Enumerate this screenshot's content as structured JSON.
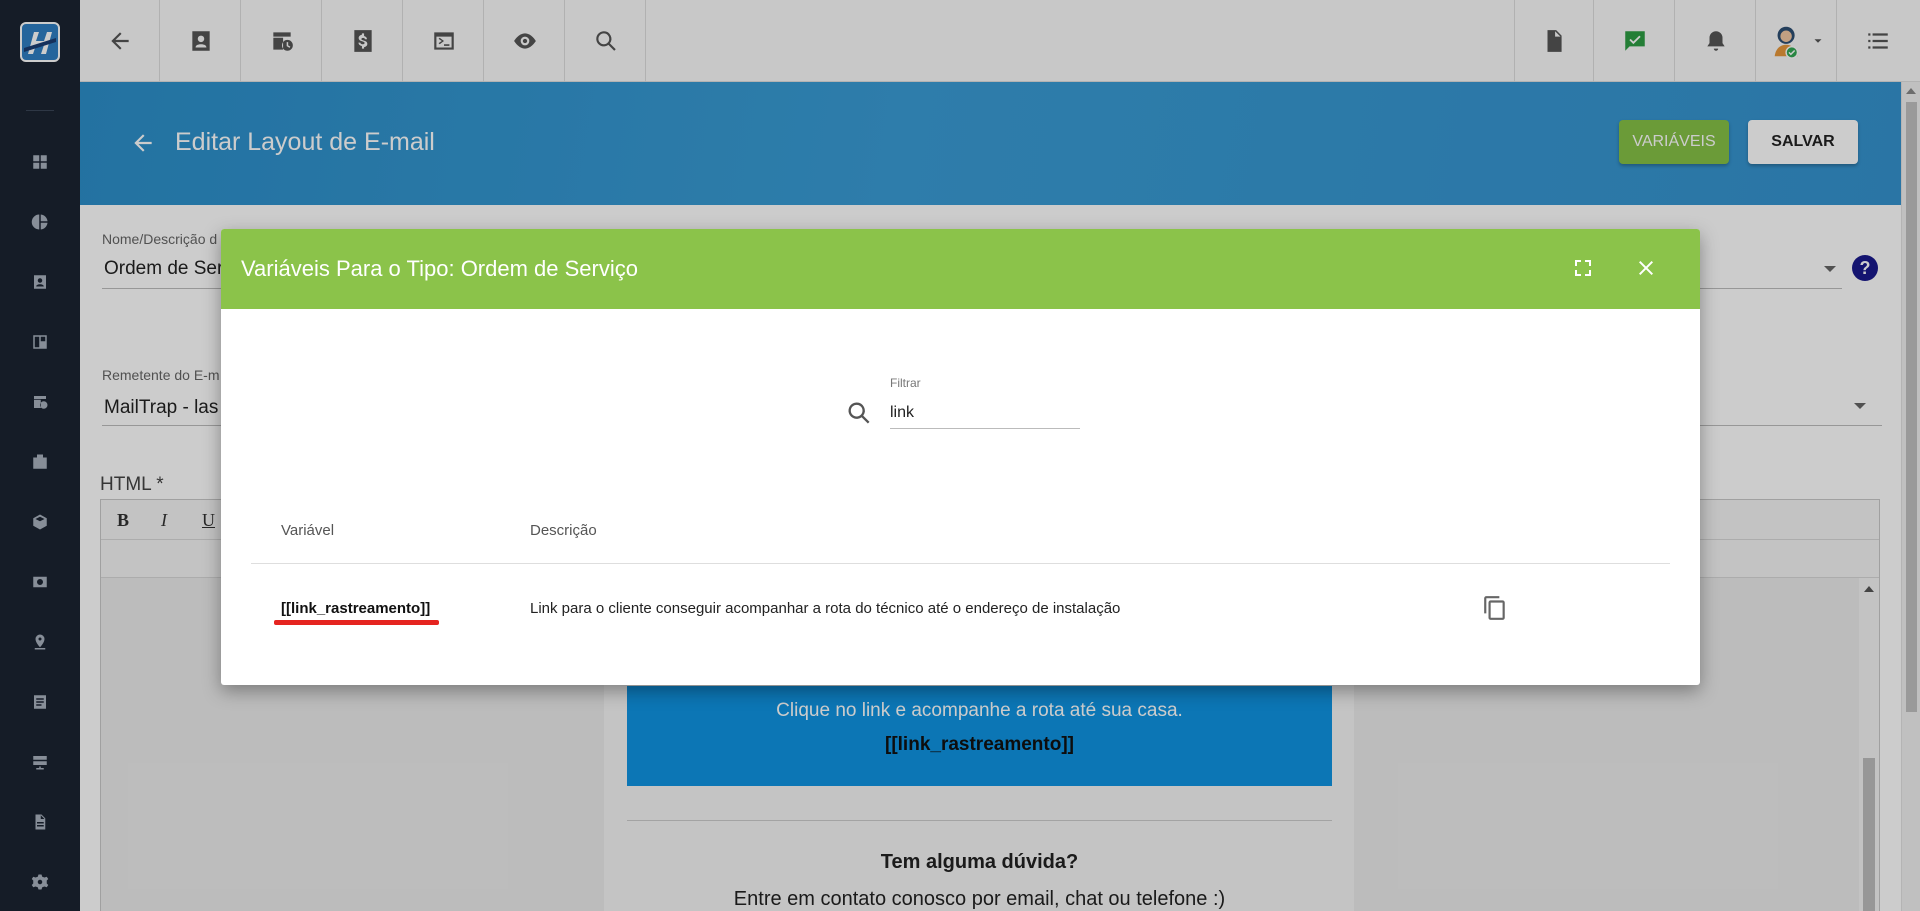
{
  "header": {
    "title": "Editar Layout de E-mail",
    "vars_button": "VARIÁVEIS",
    "save_button": "SALVAR"
  },
  "form": {
    "name_label": "Nome/Descrição d",
    "name_value": "Ordem de Ser",
    "sender_label": "Remetente do E-m",
    "sender_value": "MailTrap - las",
    "html_label": "HTML *",
    "help": "?"
  },
  "editor": {
    "tools": [
      "B",
      "I",
      "U"
    ]
  },
  "email_preview": {
    "line1": "Clique no link e acompanhe a rota até sua casa.",
    "line2": "[[link_rastreamento]]",
    "question": "Tem alguma dúvida?",
    "contact": "Entre em contato conosco por email, chat ou telefone :)"
  },
  "dialog": {
    "title": "Variáveis Para o Tipo: Ordem de Serviço",
    "filter_label": "Filtrar",
    "filter_value": "link",
    "col_variable": "Variável",
    "col_description": "Descrição",
    "rows": [
      {
        "variable": "[[link_rastreamento]]",
        "description": "Link para o cliente conseguir acompanhar a rota do técnico até o endereço de instalação"
      }
    ]
  },
  "colors": {
    "sidebar": "#1b2431",
    "header": "#3593cf",
    "dialog_header": "#8bc34a",
    "vars_button": "#86c247",
    "highlight": "#e52420"
  }
}
